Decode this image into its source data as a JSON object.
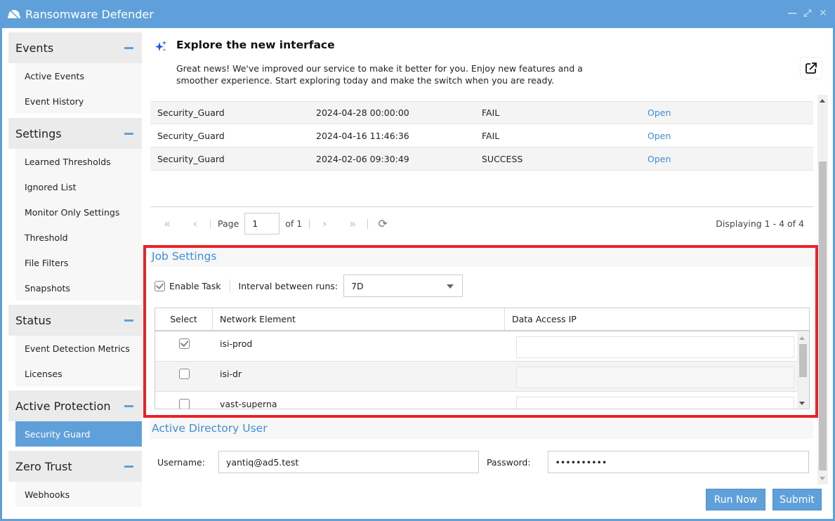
{
  "window": {
    "title": "Ransomware Defender",
    "controls": [
      "minimize-icon",
      "maximize-icon",
      "close-icon"
    ]
  },
  "sidebar": {
    "groups": [
      {
        "label": "Events",
        "items": [
          {
            "label": "Active Events"
          },
          {
            "label": "Event History"
          }
        ]
      },
      {
        "label": "Settings",
        "items": [
          {
            "label": "Learned Thresholds"
          },
          {
            "label": "Ignored List"
          },
          {
            "label": "Monitor Only Settings"
          },
          {
            "label": "Threshold"
          },
          {
            "label": "File Filters"
          },
          {
            "label": "Snapshots"
          }
        ]
      },
      {
        "label": "Status",
        "items": [
          {
            "label": "Event Detection Metrics"
          },
          {
            "label": "Licenses"
          }
        ]
      },
      {
        "label": "Active Protection",
        "items": [
          {
            "label": "Security Guard",
            "active": true
          }
        ]
      },
      {
        "label": "Zero Trust",
        "items": [
          {
            "label": "Webhooks"
          }
        ]
      }
    ]
  },
  "banner": {
    "title": "Explore the new interface",
    "text": "Great news! We've improved our service to make it better for you. Enjoy new features and a smoother experience. Start exploring today and make the switch when you are ready.",
    "icon": "sparkle-icon",
    "action_icon": "external-link-icon"
  },
  "history": {
    "rows": [
      {
        "name": "Security_Guard",
        "time": "2024-04-28 00:00:00",
        "status": "FAIL",
        "action": "Open"
      },
      {
        "name": "Security_Guard",
        "time": "2024-04-16 11:46:36",
        "status": "FAIL",
        "action": "Open"
      },
      {
        "name": "Security_Guard",
        "time": "2024-02-06 09:30:49",
        "status": "SUCCESS",
        "action": "Open"
      }
    ]
  },
  "pager": {
    "page_label": "Page",
    "page_value": "1",
    "of_label": "of 1",
    "display": "Displaying 1 - 4 of 4"
  },
  "job_settings": {
    "title": "Job Settings",
    "enable_task_label": "Enable Task",
    "enable_task_checked": true,
    "interval_label": "Interval between runs:",
    "interval_value": "7D",
    "columns": [
      "Select",
      "Network Element",
      "Data Access IP"
    ],
    "rows": [
      {
        "selected": true,
        "element": "isi-prod",
        "ip": ""
      },
      {
        "selected": false,
        "element": "isi-dr",
        "ip": ""
      },
      {
        "selected": false,
        "element": "vast-superna",
        "ip": ""
      }
    ]
  },
  "ad_user": {
    "title": "Active Directory User",
    "username_label": "Username:",
    "username_value": "yantiq@ad5.test",
    "password_label": "Password:",
    "password_value": "••••••••••"
  },
  "buttons": {
    "run_now": "Run Now",
    "submit": "Submit"
  },
  "colors": {
    "accent": "#5fa0da",
    "link": "#3b8ed8",
    "highlight": "#e8232a"
  }
}
